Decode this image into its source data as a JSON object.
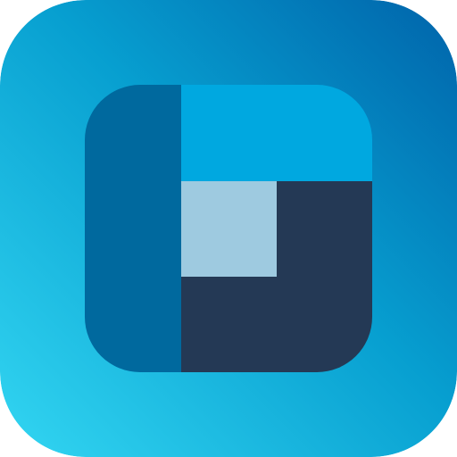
{
  "icon": {
    "name": "app-logo-icon",
    "colors": {
      "background_gradient_start": "#33D6F2",
      "background_gradient_mid": "#079FD0",
      "background_gradient_end": "#0063AA",
      "left_bar": "#00699E",
      "top_block": "#00A8E0",
      "center_square": "#9ECAE0",
      "bottom_right_block": "#243955"
    }
  }
}
